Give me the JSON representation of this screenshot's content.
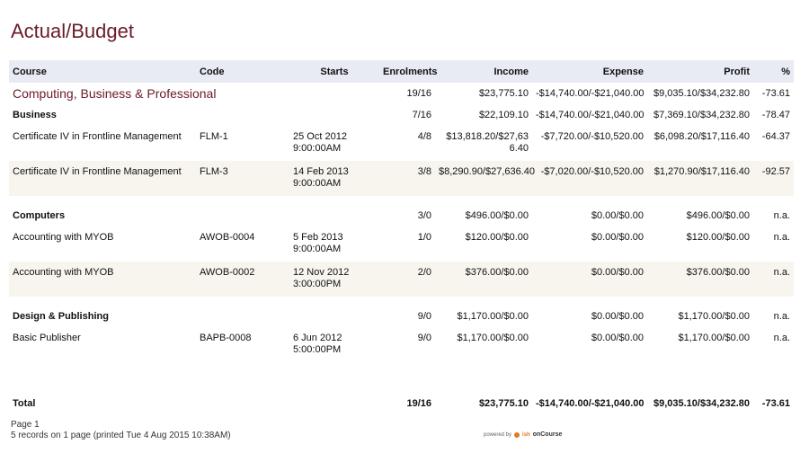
{
  "title": "Actual/Budget",
  "columns": [
    "Course",
    "Code",
    "Starts",
    "Enrolments",
    "Income",
    "Expense",
    "Profit",
    "%"
  ],
  "section": {
    "name": "Computing, Business & Professional",
    "enrolments": "19/16",
    "income": "$23,775.10",
    "expense": "-$14,740.00/-$21,040.00",
    "profit": "$9,035.10/$34,232.80",
    "pct": "-73.61"
  },
  "groups": [
    {
      "name": "Business",
      "enrolments": "7/16",
      "income": "$22,109.10",
      "expense": "-$14,740.00/-$21,040.00",
      "profit": "$7,369.10/$34,232.80",
      "pct": "-78.47",
      "items": [
        {
          "course": "Certificate IV in Frontline Management",
          "code": "FLM-1",
          "start_date": "25 Oct 2012",
          "start_time": "9:00:00AM",
          "enrolments": "4/8",
          "income": "$13,818.20/$27,636.40",
          "expense": "-$7,720.00/-$10,520.00",
          "profit": "$6,098.20/$17,116.40",
          "pct": "-64.37"
        },
        {
          "course": "Certificate IV in Frontline Management",
          "code": "FLM-3",
          "start_date": "14 Feb 2013",
          "start_time": "9:00:00AM",
          "enrolments": "3/8",
          "income": "$8,290.90/$27,636.40",
          "expense": "-$7,020.00/-$10,520.00",
          "profit": "$1,270.90/$17,116.40",
          "pct": "-92.57"
        }
      ]
    },
    {
      "name": "Computers",
      "enrolments": "3/0",
      "income": "$496.00/$0.00",
      "expense": "$0.00/$0.00",
      "profit": "$496.00/$0.00",
      "pct": "n.a.",
      "items": [
        {
          "course": "Accounting with MYOB",
          "code": "AWOB-0004",
          "start_date": "5 Feb 2013",
          "start_time": "9:00:00AM",
          "enrolments": "1/0",
          "income": "$120.00/$0.00",
          "expense": "$0.00/$0.00",
          "profit": "$120.00/$0.00",
          "pct": "n.a."
        },
        {
          "course": "Accounting with MYOB",
          "code": "AWOB-0002",
          "start_date": "12 Nov 2012",
          "start_time": "3:00:00PM",
          "enrolments": "2/0",
          "income": "$376.00/$0.00",
          "expense": "$0.00/$0.00",
          "profit": "$376.00/$0.00",
          "pct": "n.a."
        }
      ]
    },
    {
      "name": "Design & Publishing",
      "enrolments": "9/0",
      "income": "$1,170.00/$0.00",
      "expense": "$0.00/$0.00",
      "profit": "$1,170.00/$0.00",
      "pct": "n.a.",
      "items": [
        {
          "course": "Basic Publisher",
          "code": "BAPB-0008",
          "start_date": "6 Jun 2012",
          "start_time": "5:00:00PM",
          "enrolments": "9/0",
          "income": "$1,170.00/$0.00",
          "expense": "$0.00/$0.00",
          "profit": "$1,170.00/$0.00",
          "pct": "n.a."
        }
      ]
    }
  ],
  "total": {
    "label": "Total",
    "enrolments": "19/16",
    "income": "$23,775.10",
    "expense": "-$14,740.00/-$21,040.00",
    "profit": "$9,035.10/$34,232.80",
    "pct": "-73.61"
  },
  "footer": {
    "page": "Page 1",
    "records": "5 records on 1 page (printed Tue 4 Aug 2015 10:38AM)"
  },
  "branding": {
    "powered": "powered by",
    "ish": "ish",
    "oncourse": "onCourse"
  },
  "colors": {
    "title": "#6b1a2a",
    "header_bg": "#e9ebf4",
    "row_shade": "#f7f5ee"
  }
}
